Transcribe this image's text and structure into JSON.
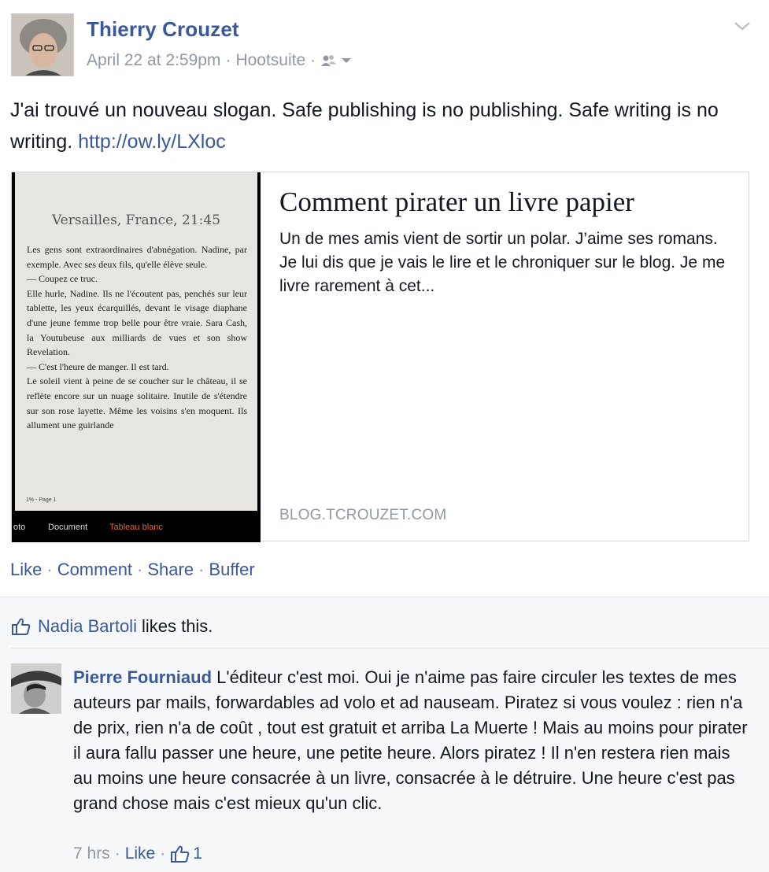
{
  "post": {
    "author": "Thierry Crouzet",
    "timestamp": "April 22 at 2:59pm",
    "separator": "·",
    "via": "Hootsuite",
    "privacy_icon": "friends-icon",
    "text": "J'ai trouvé un nouveau slogan. Safe publishing is no publishing. Safe writing is no writing.",
    "link": "http://ow.ly/LXloc"
  },
  "card": {
    "title": "Comment pirater un livre papier",
    "description": "Un de mes amis vient de sortir un polar. J’aime ses romans. Je lui dis que je vais le lire et le chroniquer sur le blog. Je me livre rarement à cet...",
    "domain": "BLOG.TCROUZET.COM",
    "thumbnail": {
      "heading": "Versailles, France, 21:45",
      "body": "Les gens sont extraordinaires d'abnégation. Nadine, par exemple. Avec ses deux fils, qu'elle élève seule.\n— Coupez ce truc.\nElle hurle, Nadine. Ils ne l'écoutent pas, penchés sur leur tablette, les yeux écarquillés, devant le visage diaphane d'une jeune femme trop belle pour être vraie. Sara Cash, la Youtubeuse aux milliards de vues et son show Revelation.\n— C'est l'heure de manger. Il est tard.\nLe soleil vient à peine de se coucher sur le château, il se reflète encore sur un nuage solitaire. Inutile de s'étendre sur son rose layette. Même les voisins s'en moquent. Ils allument une guirlande",
      "page_label": "1% - Page 1",
      "toolbar": [
        "oto",
        "Document",
        "Tableau blanc"
      ]
    }
  },
  "actions": {
    "like": "Like",
    "comment": "Comment",
    "share": "Share",
    "buffer": "Buffer",
    "sep": "·"
  },
  "likes": {
    "name": "Nadia Bartoli",
    "suffix": "likes this."
  },
  "comment": {
    "author": "Pierre Fourniaud",
    "text": "L'éditeur c'est moi. Oui je n'aime pas faire circuler les textes de mes auteurs par mails, forwardables ad volo et ad nauseam. Piratez si vous voulez : rien n'a de prix, rien n'a de coût , tout est gratuit et arriba La Muerte ! Mais au moins pour pirater il aura fallu passer une heure, une petite heure. Alors piratez ! Il n'en restera rien mais au moins une heure consacrée à un livre, consacrée à le détruire. Une heure c'est pas grand chose mais c'est mieux qu'un clic.",
    "time": "7 hrs",
    "sep": "·",
    "like": "Like",
    "like_count": "1"
  },
  "colors": {
    "link": "#3b5998",
    "meta": "#9197a3",
    "text": "#141823",
    "ufi_bg": "#f6f7f9"
  }
}
